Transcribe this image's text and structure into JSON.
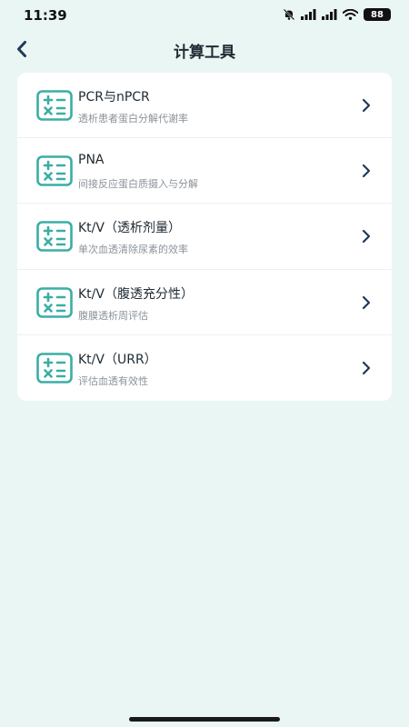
{
  "status_bar": {
    "time": "11:39",
    "battery": "88"
  },
  "nav": {
    "title": "计算工具"
  },
  "items": [
    {
      "title": "PCR与nPCR",
      "subtitle": "透析患者蛋白分解代谢率"
    },
    {
      "title": "PNA",
      "subtitle": "间接反应蛋白质摄入与分解"
    },
    {
      "title": "Kt/V（透析剂量）",
      "subtitle": "单次血透清除尿素的效率"
    },
    {
      "title": "Kt/V（腹透充分性）",
      "subtitle": "腹膜透析周评估"
    },
    {
      "title": "Kt/V（URR）",
      "subtitle": "评估血透有效性"
    }
  ],
  "colors": {
    "background": "#eaf6f3",
    "accent": "#3aaea5",
    "card": "#ffffff"
  },
  "icons": {
    "back": "chevron-left-icon",
    "item": "calculator-icon",
    "item_arrow": "chevron-right-icon"
  }
}
